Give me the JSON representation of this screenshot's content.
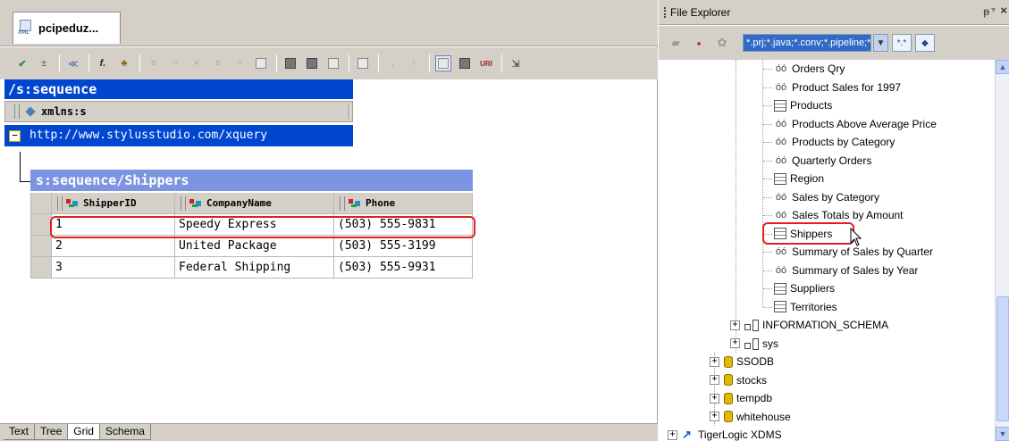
{
  "editor": {
    "document_tab": "pcipeduz...",
    "document_icon_text": "XML",
    "sequence_header": "/s:sequence",
    "attribute_name": "xmlns:s",
    "namespace_value": "http://www.stylusstudio.com/xquery",
    "collapse_symbol": "−",
    "table_title": "s:sequence/Shippers",
    "columns": [
      "ShipperID",
      "CompanyName",
      "Phone"
    ],
    "rows": [
      [
        "1",
        "Speedy Express",
        "(503) 555-9831"
      ],
      [
        "2",
        "United Package",
        "(503) 555-3199"
      ],
      [
        "3",
        "Federal Shipping",
        "(503) 555-9931"
      ]
    ],
    "highlighted_row": 1,
    "bottom_tabs": [
      "Text",
      "Tree",
      "Grid",
      "Schema"
    ],
    "active_bottom_tab": "Grid"
  },
  "file_explorer": {
    "title": "File Explorer",
    "pin_glyph": "ᵽ",
    "menu_glyph": "▼",
    "close_glyph": "×",
    "filter_value": "*.prj;*.java;*.conv;*.pipeline;*.re",
    "tree_items": [
      {
        "label": "Orders Qry",
        "icon": "view-icon"
      },
      {
        "label": "Product Sales for 1997",
        "icon": "view-icon"
      },
      {
        "label": "Products",
        "icon": "table-icon"
      },
      {
        "label": "Products Above Average Price",
        "icon": "view-icon"
      },
      {
        "label": "Products by Category",
        "icon": "view-icon"
      },
      {
        "label": "Quarterly Orders",
        "icon": "view-icon"
      },
      {
        "label": "Region",
        "icon": "table-icon"
      },
      {
        "label": "Sales by Category",
        "icon": "view-icon"
      },
      {
        "label": "Sales Totals by Amount",
        "icon": "view-icon"
      },
      {
        "label": "Shippers",
        "icon": "table-icon"
      },
      {
        "label": "Summary of Sales by Quarter",
        "icon": "view-icon"
      },
      {
        "label": "Summary of Sales by Year",
        "icon": "view-icon"
      },
      {
        "label": "Suppliers",
        "icon": "table-icon"
      },
      {
        "label": "Territories",
        "icon": "table-icon"
      }
    ],
    "schemas": [
      {
        "label": "INFORMATION_SCHEMA",
        "icon": "schema-icon"
      },
      {
        "label": "sys",
        "icon": "schema-icon"
      }
    ],
    "databases": [
      {
        "label": "SSODB",
        "icon": "database-icon"
      },
      {
        "label": "stocks",
        "icon": "database-icon"
      },
      {
        "label": "tempdb",
        "icon": "database-icon"
      },
      {
        "label": "whitehouse",
        "icon": "database-icon"
      }
    ],
    "root_server": {
      "label": "TigerLogic XDMS",
      "icon": "xdms-icon"
    },
    "selected_item": "Shippers"
  },
  "colors": {
    "sequence_header_bg": "#0046d0",
    "table_header_bg": "#7d95e0",
    "highlight_border": "#e02020",
    "filter_bg": "#3169c6"
  }
}
